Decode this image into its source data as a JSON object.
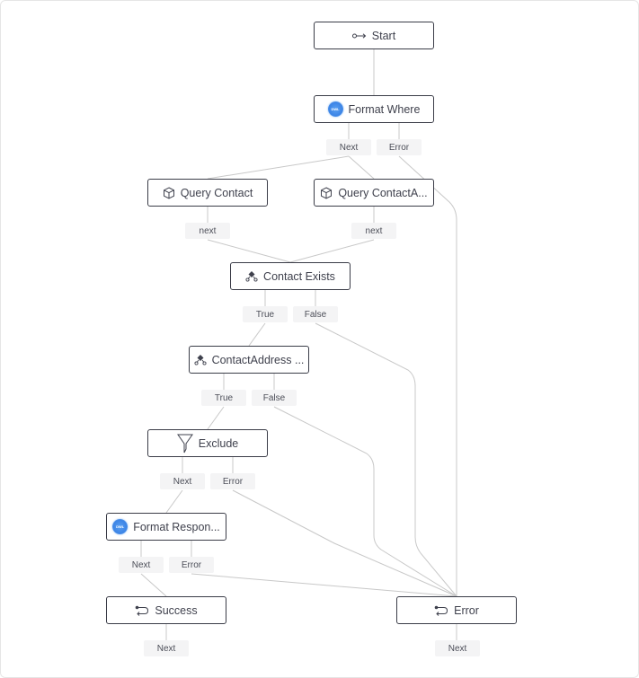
{
  "flow": {
    "nodes": {
      "start": {
        "label": "Start",
        "icon": "arrow-connector-icon"
      },
      "format_where": {
        "label": "Format Where",
        "icon": "dataweave-icon",
        "icon_text": "DWL"
      },
      "query_contact": {
        "label": "Query Contact",
        "icon": "cube-icon"
      },
      "query_contact_address": {
        "label": "Query ContactA...",
        "icon": "cube-icon"
      },
      "contact_exists": {
        "label": "Contact Exists",
        "icon": "decision-icon"
      },
      "contact_address_exists": {
        "label": "ContactAddress ...",
        "icon": "decision-icon"
      },
      "exclude": {
        "label": "Exclude",
        "icon": "filter-icon"
      },
      "format_response": {
        "label": "Format Respon...",
        "icon": "dataweave-icon",
        "icon_text": "DWL"
      },
      "success": {
        "label": "Success",
        "icon": "return-icon"
      },
      "error": {
        "label": "Error",
        "icon": "return-icon"
      }
    },
    "ports": {
      "format_where_next": "Next",
      "format_where_error": "Error",
      "query_contact_next": "next",
      "query_contact_address_next": "next",
      "contact_exists_true": "True",
      "contact_exists_false": "False",
      "contact_address_true": "True",
      "contact_address_false": "False",
      "exclude_next": "Next",
      "exclude_error": "Error",
      "format_response_next": "Next",
      "format_response_error": "Error",
      "success_next": "Next",
      "error_next": "Next"
    },
    "edges": [
      {
        "from": "start",
        "to": "format_where"
      },
      {
        "from": "format_where_next",
        "to": "query_contact"
      },
      {
        "from": "format_where_next",
        "to": "query_contact_address"
      },
      {
        "from": "format_where_error",
        "to": "error"
      },
      {
        "from": "query_contact_next",
        "to": "contact_exists"
      },
      {
        "from": "query_contact_address_next",
        "to": "contact_exists"
      },
      {
        "from": "contact_exists_true",
        "to": "contact_address_exists"
      },
      {
        "from": "contact_exists_false",
        "to": "error"
      },
      {
        "from": "contact_address_true",
        "to": "exclude"
      },
      {
        "from": "contact_address_false",
        "to": "error"
      },
      {
        "from": "exclude_next",
        "to": "format_response"
      },
      {
        "from": "exclude_error",
        "to": "error"
      },
      {
        "from": "format_response_next",
        "to": "success"
      },
      {
        "from": "format_response_error",
        "to": "error"
      }
    ],
    "colors": {
      "node_border": "#3a3c47",
      "edge": "#c8c8c8",
      "port_bg": "#f4f4f5",
      "dataweave_blue": "#3d85e6"
    }
  }
}
